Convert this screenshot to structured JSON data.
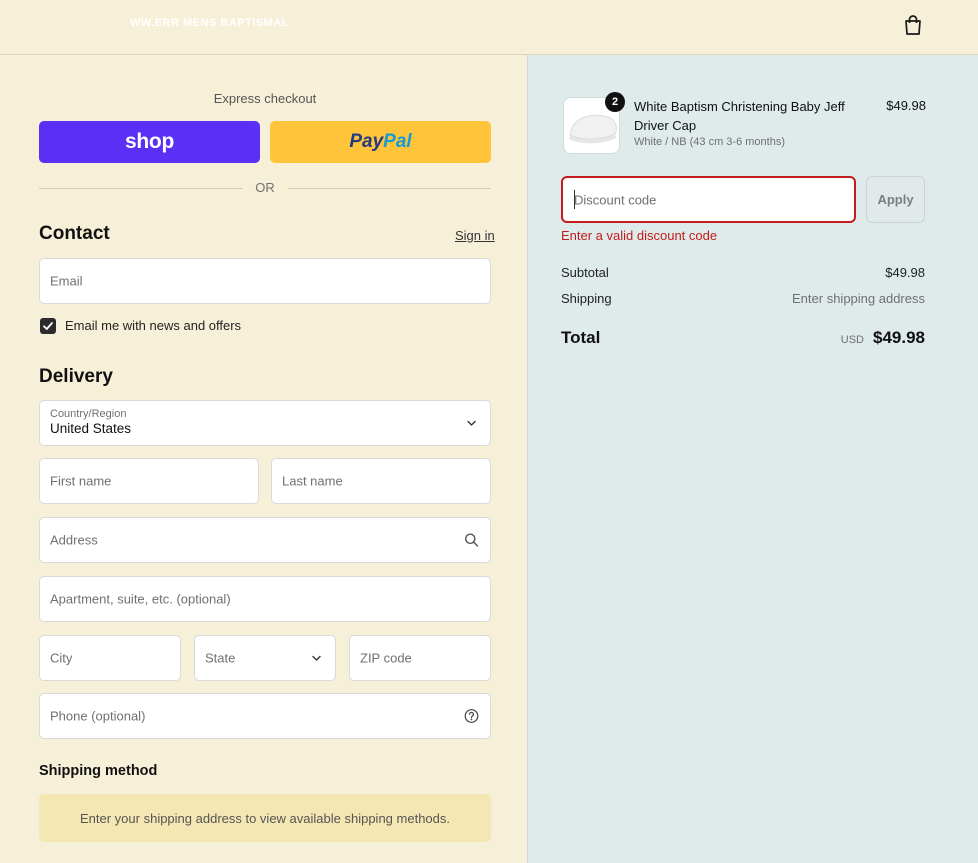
{
  "header": {
    "logo_text": "WW.ERR MENS BAPTISMAL"
  },
  "express": {
    "title": "Express checkout",
    "shop_label": "shop",
    "paypal_part1": "Pay",
    "paypal_part2": "Pal",
    "or_text": "OR"
  },
  "contact": {
    "title": "Contact",
    "sign_in": "Sign in",
    "email_placeholder": "Email",
    "newsletter_label": "Email me with news and offers",
    "newsletter_checked": true
  },
  "delivery": {
    "title": "Delivery",
    "country_label": "Country/Region",
    "country_value": "United States",
    "first_name_placeholder": "First name",
    "last_name_placeholder": "Last name",
    "address_placeholder": "Address",
    "apartment_placeholder": "Apartment, suite, etc. (optional)",
    "city_placeholder": "City",
    "state_placeholder": "State",
    "zip_placeholder": "ZIP code",
    "phone_placeholder": "Phone (optional)"
  },
  "shipping": {
    "title": "Shipping method",
    "message": "Enter your shipping address to view available shipping methods."
  },
  "order": {
    "quantity": "2",
    "product_name": "White Baptism Christening Baby Jeff Driver Cap",
    "product_variant": "White / NB (43 cm 3-6 months)",
    "product_price": "$49.98",
    "discount_placeholder": "Discount code",
    "apply_label": "Apply",
    "discount_error": "Enter a valid discount code",
    "subtotal_label": "Subtotal",
    "subtotal_value": "$49.98",
    "shipping_label": "Shipping",
    "shipping_value": "Enter shipping address",
    "total_label": "Total",
    "total_currency": "USD",
    "total_value": "$49.98"
  },
  "colors": {
    "left_bg": "#f7f0d9",
    "right_bg": "#dfeaea",
    "shop_purple": "#5a31f4",
    "paypal_yellow": "#ffc439",
    "error_red": "#c41c1c"
  },
  "icons": [
    "bag-icon",
    "chevron-down-icon",
    "search-icon",
    "help-circle-icon",
    "check-icon"
  ]
}
